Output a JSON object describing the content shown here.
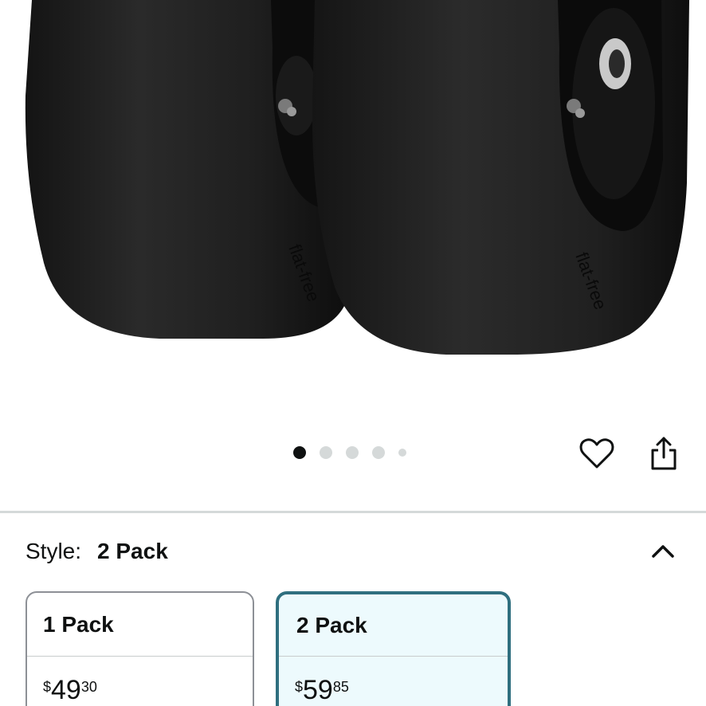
{
  "product": {
    "image_alt": "Two black smooth tread turf tires on black rims",
    "tire_branding": "flat-free"
  },
  "carousel": {
    "total": 5,
    "active_index": 0
  },
  "actions": {
    "favorite_icon": "heart-icon",
    "share_icon": "share-icon"
  },
  "style": {
    "label": "Style:",
    "value": "2 Pack",
    "toggle_icon": "chevron-up-icon"
  },
  "options": [
    {
      "title": "1 Pack",
      "currency": "$",
      "price_whole": "49",
      "price_fraction": "30",
      "selected": false
    },
    {
      "title": "2 Pack",
      "currency": "$",
      "price_whole": "59",
      "price_fraction": "85",
      "selected": true
    }
  ],
  "colors": {
    "selected_border": "#2f6f7f",
    "selected_bg": "#edfafd",
    "tire": "#1e1e1e",
    "dot_active": "#0f1111",
    "dot_inactive": "#d5d9d9"
  }
}
